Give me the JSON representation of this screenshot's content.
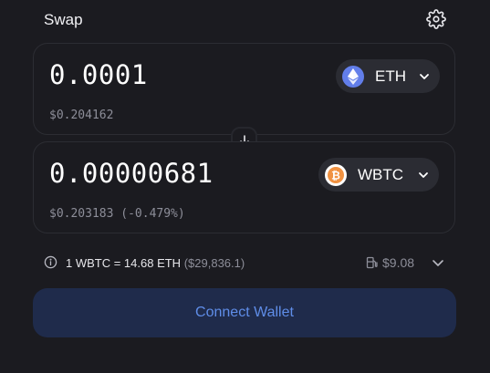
{
  "header": {
    "title": "Swap",
    "settings_icon": "gear-icon"
  },
  "input_panel": {
    "amount": "0.0001",
    "fiat_value": "$0.204162",
    "token": {
      "symbol": "ETH",
      "icon": "eth-icon",
      "logo_color": "#627eea"
    }
  },
  "switch": {
    "icon": "arrow-down-icon"
  },
  "output_panel": {
    "amount": "0.00000681",
    "fiat_value": "$0.203183 (-0.479%)",
    "token": {
      "symbol": "WBTC",
      "icon": "btc-icon",
      "logo_color": "#f09242"
    }
  },
  "rate": {
    "icon": "info-icon",
    "text": "1 WBTC = 14.68 ETH",
    "usd": "($29,836.1)"
  },
  "gas": {
    "icon": "gas-pump-icon",
    "value": "$9.08"
  },
  "expand_icon": "chevron-down-icon",
  "cta": {
    "label": "Connect Wallet"
  },
  "colors": {
    "background": "#1b1b20",
    "panel_border": "#2c2d33",
    "token_button": "#2b2c33",
    "secondary_text": "#8d8e99",
    "cta_background": "#1f2b4b",
    "cta_text": "#5f8de8"
  }
}
